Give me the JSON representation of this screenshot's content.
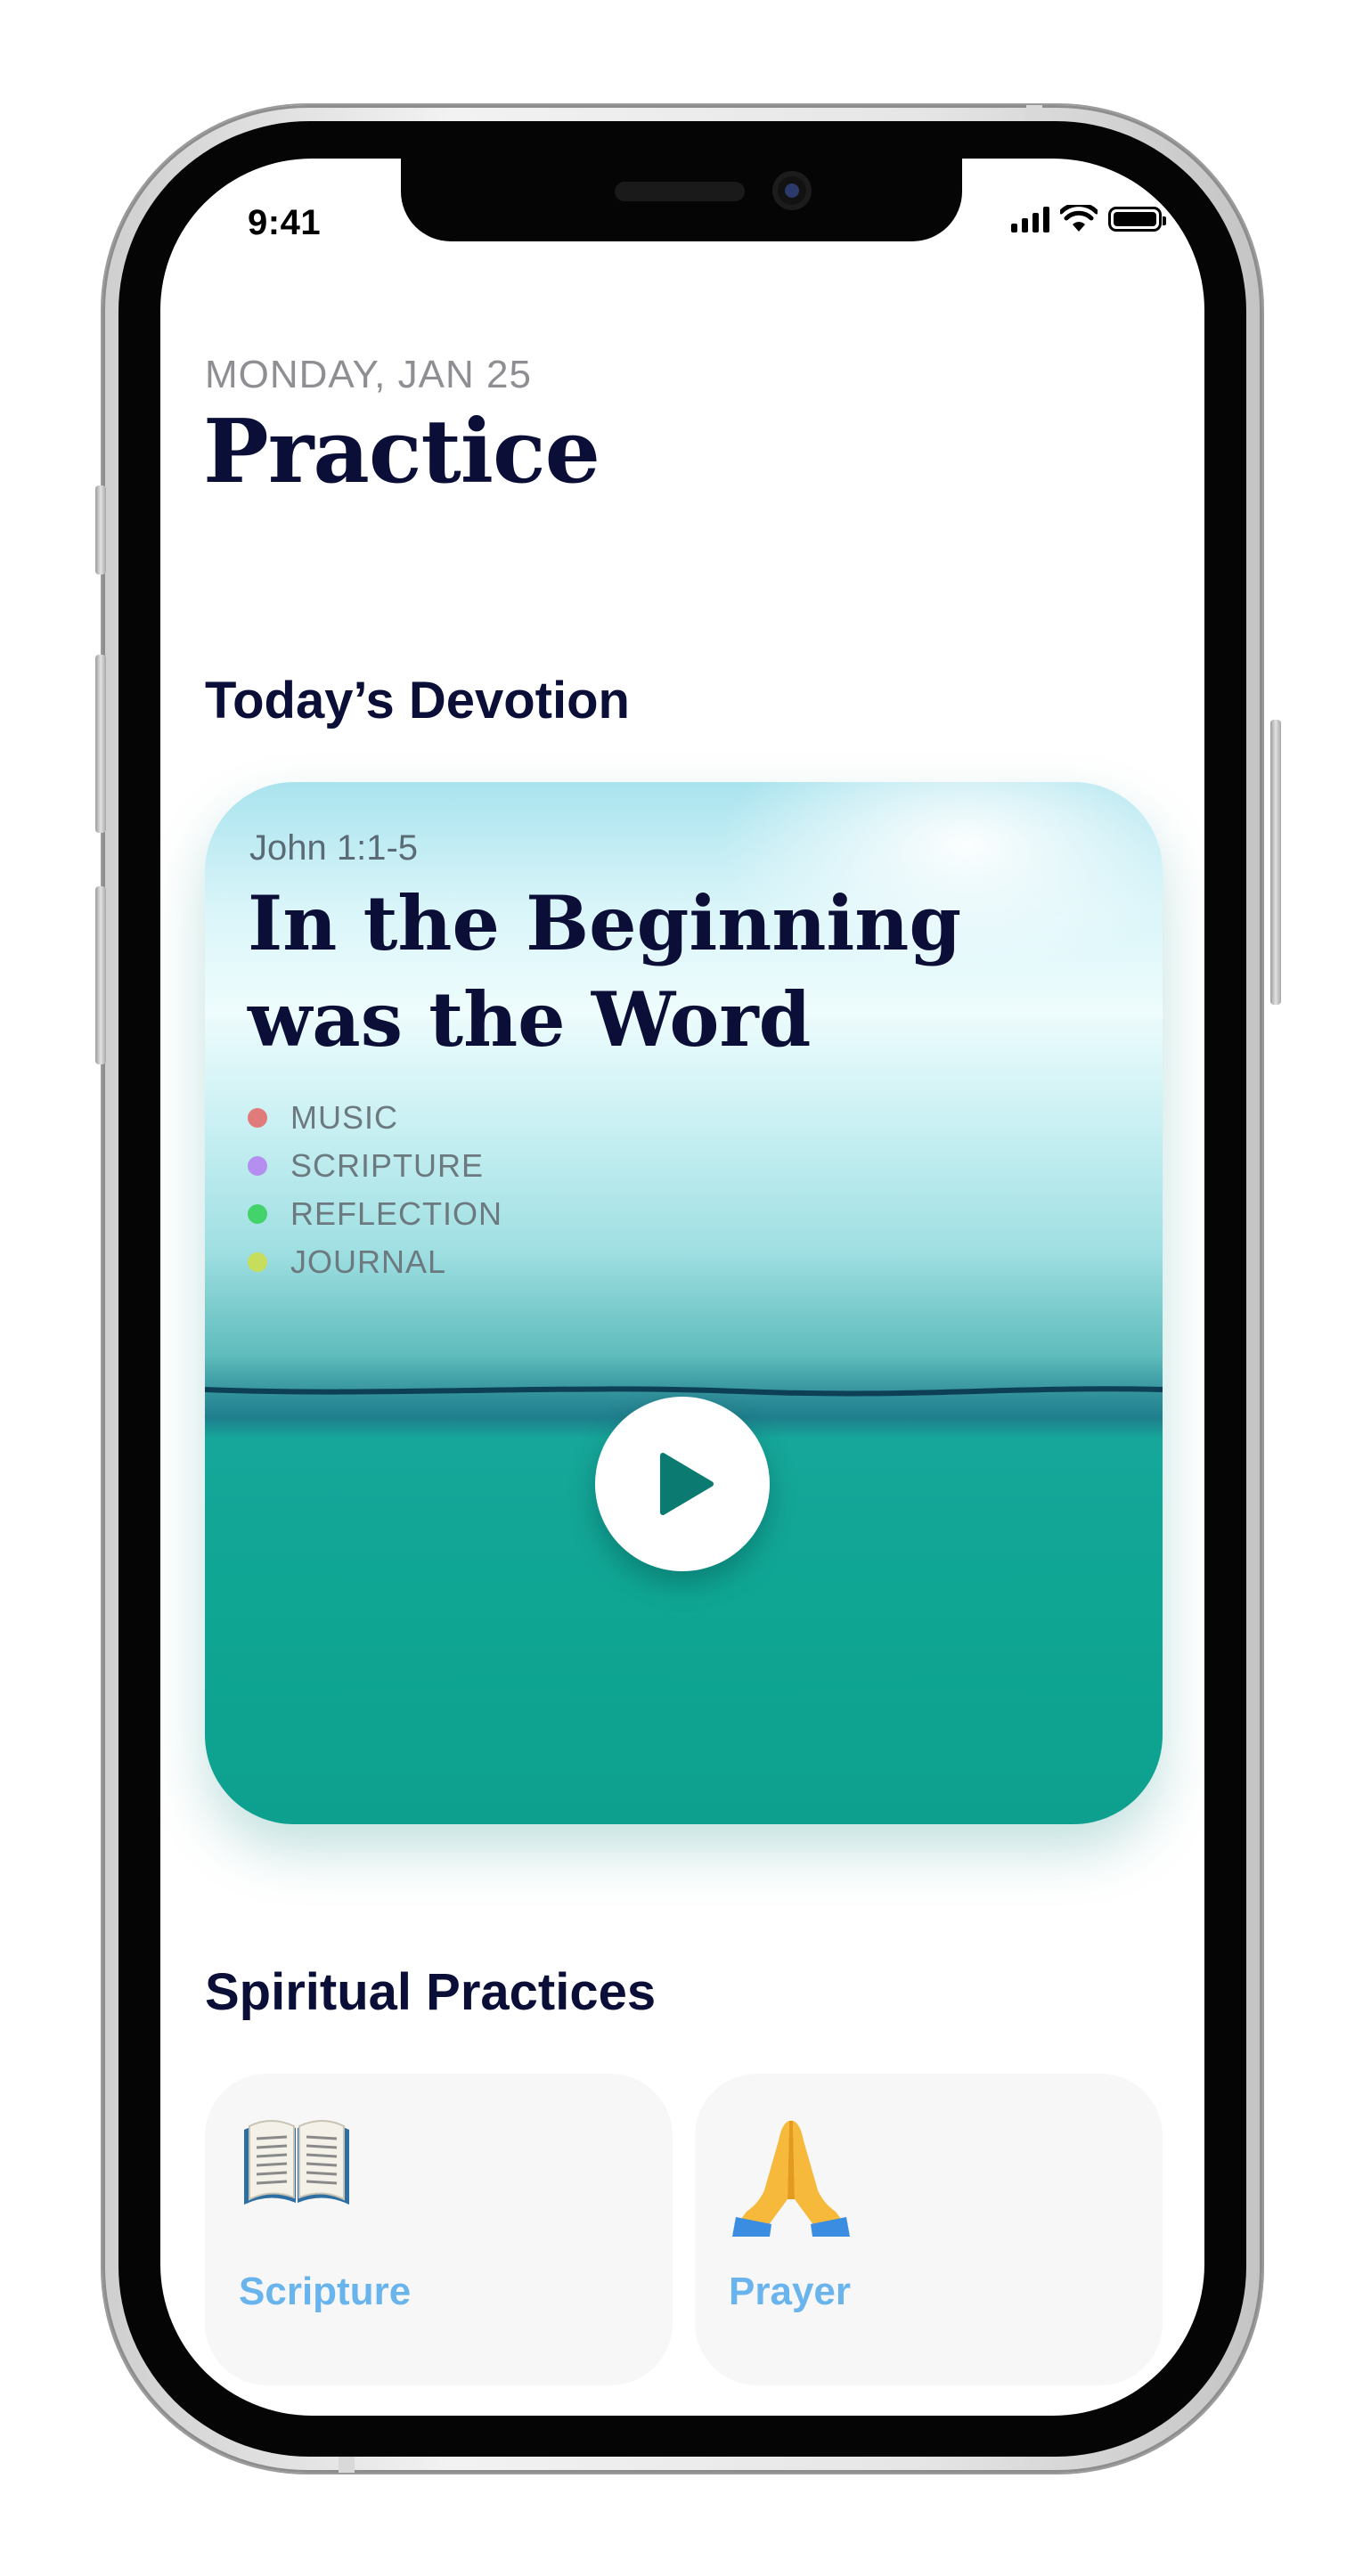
{
  "status_bar": {
    "time": "9:41"
  },
  "header": {
    "date": "MONDAY, JAN 25",
    "title": "Practice"
  },
  "devotion": {
    "section_title": "Today’s Devotion",
    "passage": "John 1:1-5",
    "title_line1": "In the Beginning",
    "title_line2": "was the Word",
    "tags": [
      {
        "label": "MUSIC",
        "color": "#e07b7b"
      },
      {
        "label": "SCRIPTURE",
        "color": "#b48ff0"
      },
      {
        "label": "REFLECTION",
        "color": "#43d36a"
      },
      {
        "label": "JOURNAL",
        "color": "#c7dd5c"
      }
    ],
    "play_icon": "play-icon"
  },
  "practices": {
    "section_title": "Spiritual Practices",
    "items": [
      {
        "label": "Scripture",
        "icon": "open-book-icon"
      },
      {
        "label": "Prayer",
        "icon": "praying-hands-icon"
      }
    ]
  },
  "colors": {
    "title": "#0b0f38",
    "accent": "#6ab4ee",
    "card_teal": "#0fa694"
  }
}
